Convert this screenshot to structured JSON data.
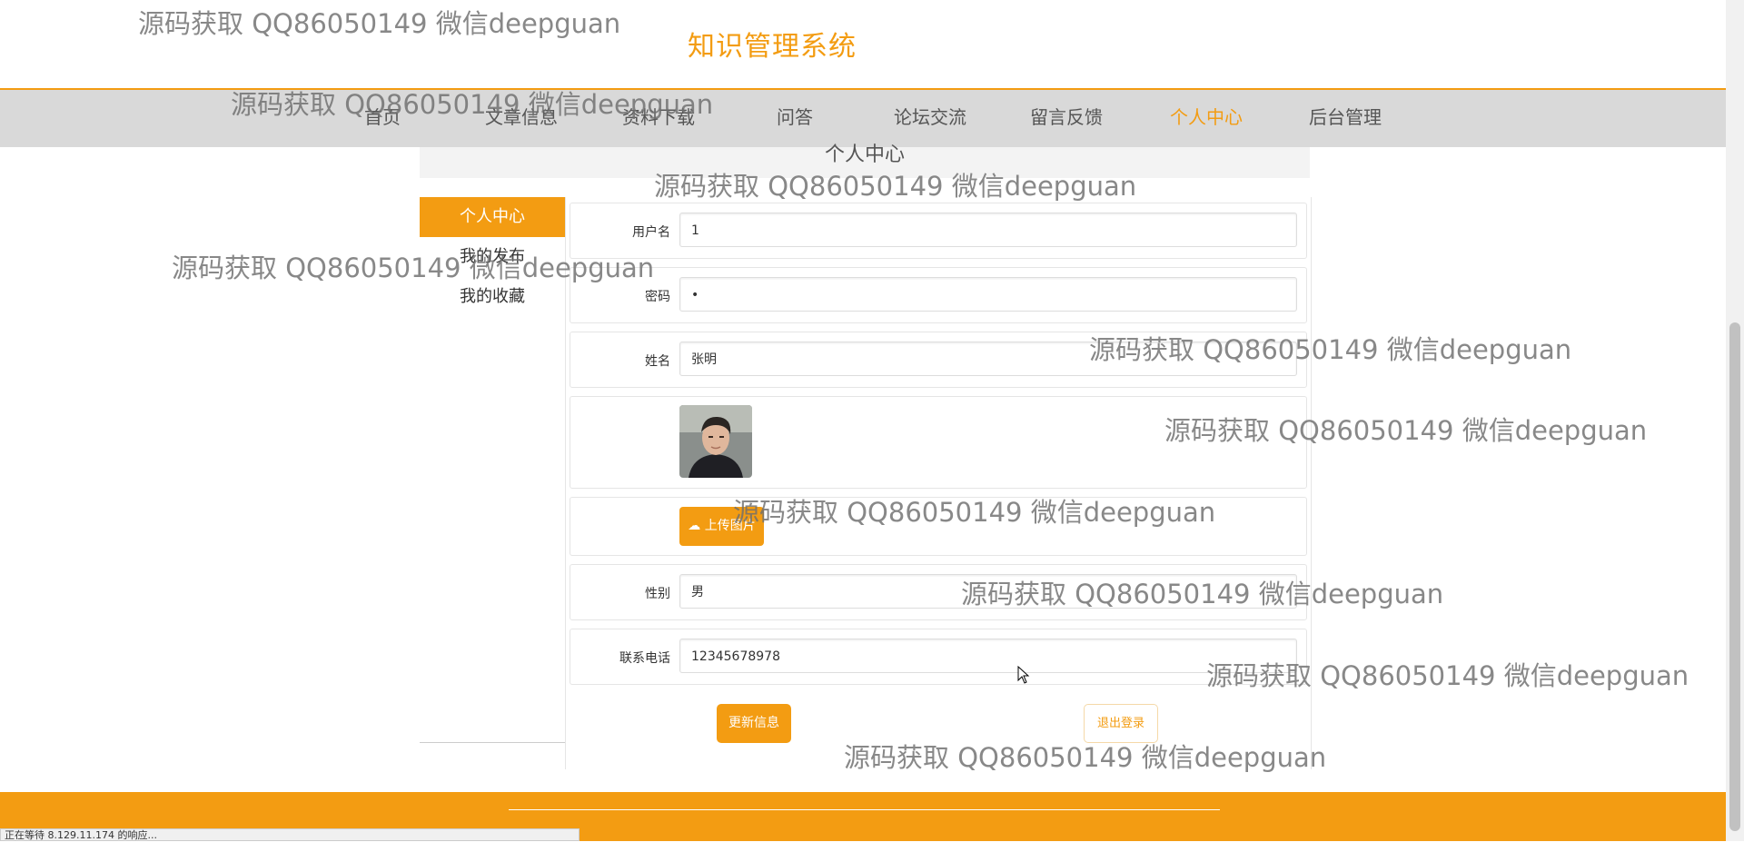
{
  "header": {
    "title": "知识管理系统"
  },
  "nav": {
    "items": [
      {
        "label": "首页"
      },
      {
        "label": "文章信息"
      },
      {
        "label": "资料下载"
      },
      {
        "label": "问答"
      },
      {
        "label": "论坛交流"
      },
      {
        "label": "留言反馈"
      },
      {
        "label": "个人中心",
        "active": true
      },
      {
        "label": "后台管理"
      }
    ]
  },
  "page": {
    "heading": "个人中心"
  },
  "sidebar": {
    "title": "个人中心",
    "links": [
      {
        "label": "我的发布"
      },
      {
        "label": "我的收藏"
      }
    ]
  },
  "form": {
    "username": {
      "label": "用户名",
      "value": "1"
    },
    "password": {
      "label": "密码",
      "value": "•"
    },
    "name": {
      "label": "姓名",
      "value": "张明"
    },
    "avatar": {
      "icon": "avatar-photo"
    },
    "upload": {
      "label": "上传图片",
      "icon": "cloud-upload-icon"
    },
    "gender": {
      "label": "性别",
      "value": "男"
    },
    "phone": {
      "label": "联系电话",
      "value": "12345678978"
    },
    "update_label": "更新信息",
    "logout_label": "退出登录"
  },
  "status": {
    "text": "正在等待 8.129.11.174 的响应..."
  },
  "watermark": "源码获取 QQ86050149 微信deepguan",
  "colors": {
    "accent": "#f39c12",
    "nav_bg": "#d9d9d9"
  }
}
